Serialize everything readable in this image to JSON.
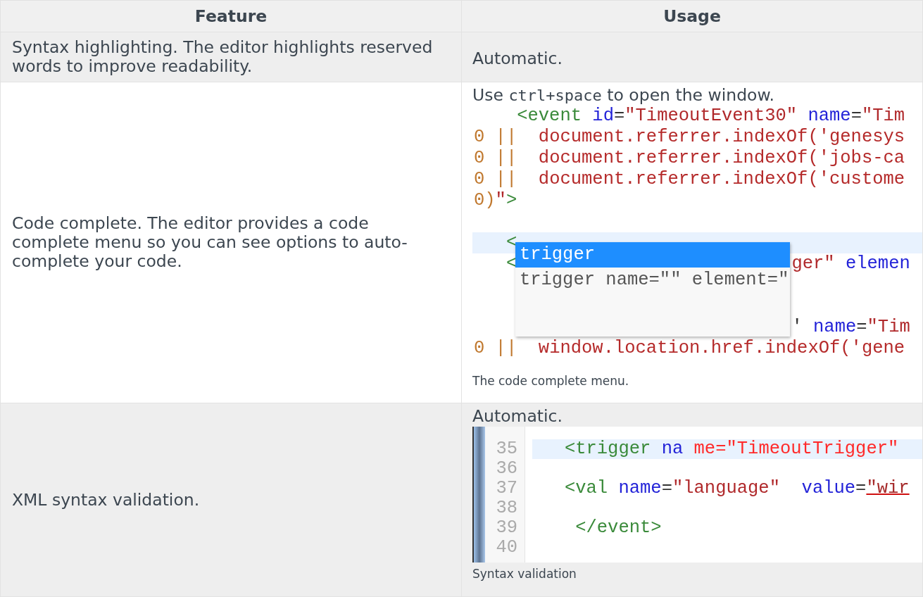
{
  "table": {
    "columns": [
      {
        "label": "Feature"
      },
      {
        "label": "Usage"
      }
    ],
    "rows": [
      {
        "feature": "Syntax highlighting. The editor highlights reserved words to improve readability.",
        "usage": {
          "text": "Automatic."
        }
      },
      {
        "feature": "Code complete. The editor provides a code complete menu so you can see options to auto-complete your code.",
        "usage": {
          "text_before": "Use ",
          "code": "ctrl+space",
          "text_after": " to open the window.",
          "figure": {
            "kind": "completion-editor",
            "caption": "The code complete menu.",
            "lines": [
              {
                "highlighted": false,
                "tokens": [
                  {
                    "kind": "tag",
                    "text": "    <event "
                  },
                  {
                    "kind": "attr",
                    "text": "id"
                  },
                  {
                    "kind": "punct",
                    "text": "="
                  },
                  {
                    "kind": "string",
                    "text": "\"TimeoutEvent30\" "
                  },
                  {
                    "kind": "attr",
                    "text": "name"
                  },
                  {
                    "kind": "punct",
                    "text": "="
                  },
                  {
                    "kind": "string",
                    "text": "\"Tim"
                  }
                ]
              },
              {
                "highlighted": false,
                "tokens": [
                  {
                    "kind": "operator",
                    "text": "0 ||  "
                  },
                  {
                    "kind": "script",
                    "text": "document.referrer.indexOf('genesys"
                  }
                ]
              },
              {
                "highlighted": false,
                "tokens": [
                  {
                    "kind": "operator",
                    "text": "0 ||  "
                  },
                  {
                    "kind": "script",
                    "text": "document.referrer.indexOf('jobs-ca"
                  }
                ]
              },
              {
                "highlighted": false,
                "tokens": [
                  {
                    "kind": "operator",
                    "text": "0 ||  "
                  },
                  {
                    "kind": "script",
                    "text": "document.referrer.indexOf('custome"
                  }
                ]
              },
              {
                "highlighted": false,
                "tokens": [
                  {
                    "kind": "operator",
                    "text": "0)"
                  },
                  {
                    "kind": "string",
                    "text": "\""
                  },
                  {
                    "kind": "tag",
                    "text": ">"
                  }
                ]
              },
              {
                "highlighted": false
              },
              {
                "highlighted": true,
                "tokens": [
                  {
                    "kind": "tag",
                    "text": "   <"
                  }
                ]
              },
              {
                "highlighted": false,
                "parts": [
                  {
                    "kind": "before-popup",
                    "tokens": [
                      {
                        "kind": "tag",
                        "text": "   <"
                      }
                    ]
                  },
                  {
                    "kind": "after-popup",
                    "tokens": [
                      {
                        "kind": "string",
                        "text": "ger\" "
                      },
                      {
                        "kind": "attr",
                        "text": "elemen"
                      }
                    ]
                  }
                ]
              },
              {
                "highlighted": false
              },
              {
                "highlighted": false
              },
              {
                "highlighted": false,
                "parts": [
                  {
                    "kind": "after-popup",
                    "tokens": [
                      {
                        "kind": "punct",
                        "text": "' "
                      },
                      {
                        "kind": "attr",
                        "text": "name"
                      },
                      {
                        "kind": "punct",
                        "text": "="
                      },
                      {
                        "kind": "string",
                        "text": "\"Tim"
                      }
                    ]
                  }
                ]
              },
              {
                "highlighted": false,
                "tokens": [
                  {
                    "kind": "operator",
                    "text": "0 ||  "
                  },
                  {
                    "kind": "script",
                    "text": "window.location.href.indexOf('gene"
                  }
                ]
              }
            ],
            "popup": {
              "items": [
                {
                  "label": "trigger",
                  "selected": true
                },
                {
                  "label": "trigger name=\"\" element=\"",
                  "selected": false
                }
              ]
            }
          }
        }
      },
      {
        "feature": "XML syntax validation.",
        "usage": {
          "text": "Automatic.",
          "figure": {
            "kind": "numbered-editor",
            "caption": "Syntax validation",
            "lines": [
              {
                "number": "35",
                "highlighted": true,
                "tokens": [
                  {
                    "kind": "tag",
                    "text": "   <trigger "
                  },
                  {
                    "kind": "attr",
                    "text": "na "
                  },
                  {
                    "kind": "invalid",
                    "text": "me=\"TimeoutTrigger\""
                  }
                ]
              },
              {
                "number": "36",
                "highlighted": false
              },
              {
                "number": "37",
                "highlighted": false,
                "tokens": [
                  {
                    "kind": "tag",
                    "text": "   <val "
                  },
                  {
                    "kind": "attr",
                    "text": "name"
                  },
                  {
                    "kind": "punct",
                    "text": "="
                  },
                  {
                    "kind": "string",
                    "text": "\"language\"  "
                  },
                  {
                    "kind": "attr",
                    "text": "value"
                  },
                  {
                    "kind": "punct",
                    "text": "="
                  },
                  {
                    "kind": "error",
                    "text": "\"wir"
                  }
                ]
              },
              {
                "number": "38",
                "highlighted": false
              },
              {
                "number": "39",
                "highlighted": false,
                "tokens": [
                  {
                    "kind": "tag",
                    "text": "    </event>"
                  }
                ]
              },
              {
                "number": "40",
                "highlighted": false
              }
            ]
          }
        }
      }
    ]
  }
}
